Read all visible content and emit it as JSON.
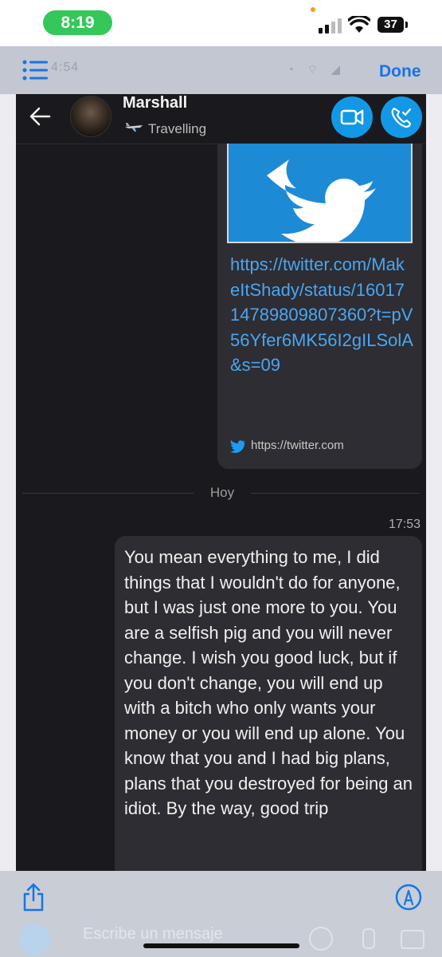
{
  "status_bar": {
    "time": "8:19",
    "battery": "37"
  },
  "preview_bar": {
    "ghost_time": "4:54",
    "done_label": "Done"
  },
  "chat": {
    "contact_name": "Marshall",
    "contact_status": "Travelling",
    "shared_link": "https://twitter.com/MakeItShady/status/1601714789809807360?t=pV56Yfer6MK56I2gILSolA&s=09",
    "link_preview": "https://twitter.com",
    "day_label": "Hoy",
    "message_time": "17:53",
    "message_text": "You mean everything to me, I did things that I wouldn't do for anyone, but I was just one more to you. You are a selfish pig and you will never change. I wish you good luck, but if you don't change, you will end up with a bitch who only wants your money or you will end up alone. You know that you and I had big plans, plans that you destroyed for being an idiot. By the way, good trip"
  },
  "composer": {
    "placeholder": "Escribe un mensaje"
  },
  "colors": {
    "accent_blue": "#1298e6",
    "done_blue": "#1a73e8",
    "status_green": "#34c759",
    "chat_background": "#1a1a1e",
    "bubble": "#2d2d33",
    "link": "#4aa6f2"
  },
  "icons": [
    "list-icon",
    "back-arrow-icon",
    "airplane-icon",
    "video-call-icon",
    "phone-call-icon",
    "twitter-bird-icon",
    "share-icon",
    "markup-icon",
    "signal-icon",
    "wifi-icon",
    "battery-icon"
  ]
}
